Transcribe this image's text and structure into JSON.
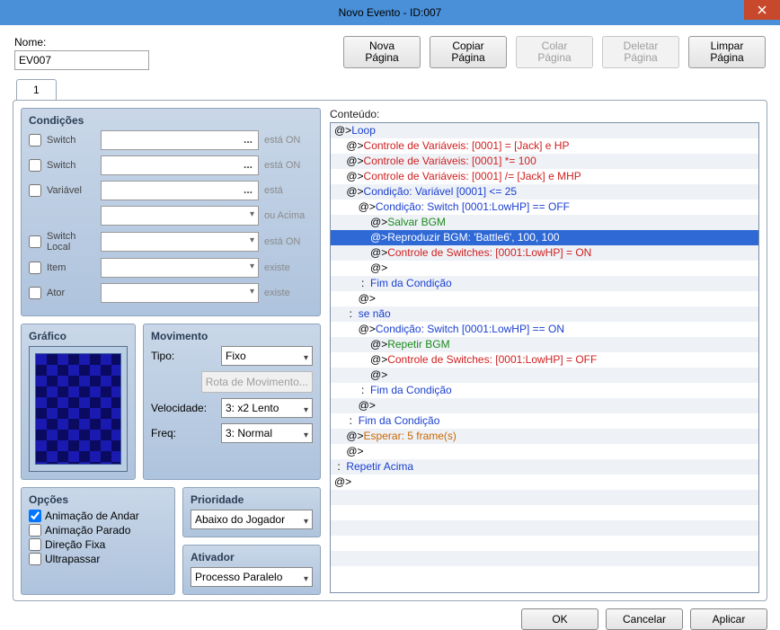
{
  "title": "Novo Evento - ID:007",
  "name": {
    "label": "Nome:",
    "value": "EV007"
  },
  "toolbar": {
    "nova": "Nova\nPágina",
    "copiar": "Copiar\nPágina",
    "colar": "Colar\nPágina",
    "deletar": "Deletar\nPágina",
    "limpar": "Limpar\nPágina"
  },
  "tabs": [
    "1"
  ],
  "conditions": {
    "title": "Condições",
    "rows": [
      {
        "label": "Switch",
        "suffix": "está ON",
        "type": "ellipsis"
      },
      {
        "label": "Switch",
        "suffix": "está ON",
        "type": "ellipsis"
      },
      {
        "label": "Variável",
        "suffix": "está",
        "type": "ellipsis"
      },
      {
        "label": "",
        "suffix": "ou Acima",
        "type": "combo",
        "indent": true
      },
      {
        "label": "Switch Local",
        "suffix": "está ON",
        "type": "combo"
      },
      {
        "label": "Item",
        "suffix": "existe",
        "type": "combo"
      },
      {
        "label": "Ator",
        "suffix": "existe",
        "type": "combo"
      }
    ]
  },
  "graphic": {
    "title": "Gráfico"
  },
  "movement": {
    "title": "Movimento",
    "type_label": "Tipo:",
    "type_value": "Fixo",
    "rota": "Rota de Movimento...",
    "speed_label": "Velocidade:",
    "speed_value": "3: x2 Lento",
    "freq_label": "Freq:",
    "freq_value": "3: Normal"
  },
  "options": {
    "title": "Opções",
    "items": [
      {
        "label": "Animação de Andar",
        "checked": true
      },
      {
        "label": "Animação Parado",
        "checked": false
      },
      {
        "label": "Direção Fixa",
        "checked": false
      },
      {
        "label": "Ultrapassar",
        "checked": false
      }
    ]
  },
  "priority": {
    "title": "Prioridade",
    "value": "Abaixo do Jogador"
  },
  "trigger": {
    "title": "Ativador",
    "value": "Processo Paralelo"
  },
  "content": {
    "title": "Conteúdo:",
    "lines": [
      {
        "indent": 0,
        "segs": [
          [
            "black",
            "@>"
          ],
          [
            "blue",
            "Loop"
          ]
        ]
      },
      {
        "indent": 1,
        "segs": [
          [
            "black",
            "@>"
          ],
          [
            "red",
            "Controle de Variáveis: [0001] = [Jack] e HP"
          ]
        ]
      },
      {
        "indent": 1,
        "segs": [
          [
            "black",
            "@>"
          ],
          [
            "red",
            "Controle de Variáveis: [0001] *= 100"
          ]
        ]
      },
      {
        "indent": 1,
        "segs": [
          [
            "black",
            "@>"
          ],
          [
            "red",
            "Controle de Variáveis: [0001] /= [Jack] e MHP"
          ]
        ]
      },
      {
        "indent": 1,
        "segs": [
          [
            "black",
            "@>"
          ],
          [
            "blue",
            "Condição: Variável [0001] <= 25"
          ]
        ]
      },
      {
        "indent": 2,
        "segs": [
          [
            "black",
            "@>"
          ],
          [
            "blue",
            "Condição: Switch [0001:LowHP] == OFF"
          ]
        ]
      },
      {
        "indent": 3,
        "segs": [
          [
            "black",
            "@>"
          ],
          [
            "green",
            "Salvar BGM"
          ]
        ]
      },
      {
        "indent": 3,
        "selected": true,
        "segs": [
          [
            "black",
            "@>"
          ],
          [
            "green",
            "Reproduzir BGM: 'Battle6', 100, 100"
          ]
        ]
      },
      {
        "indent": 3,
        "segs": [
          [
            "black",
            "@>"
          ],
          [
            "red",
            "Controle de Switches: [0001:LowHP] = ON"
          ]
        ]
      },
      {
        "indent": 3,
        "segs": [
          [
            "black",
            "@>"
          ]
        ]
      },
      {
        "indent": 2,
        "segs": [
          [
            "black",
            " :  "
          ],
          [
            "blue",
            "Fim da Condição"
          ]
        ]
      },
      {
        "indent": 2,
        "segs": [
          [
            "black",
            "@>"
          ]
        ]
      },
      {
        "indent": 1,
        "segs": [
          [
            "black",
            " :  "
          ],
          [
            "blue",
            "se não"
          ]
        ]
      },
      {
        "indent": 2,
        "segs": [
          [
            "black",
            "@>"
          ],
          [
            "blue",
            "Condição: Switch [0001:LowHP] == ON"
          ]
        ]
      },
      {
        "indent": 3,
        "segs": [
          [
            "black",
            "@>"
          ],
          [
            "green",
            "Repetir BGM"
          ]
        ]
      },
      {
        "indent": 3,
        "segs": [
          [
            "black",
            "@>"
          ],
          [
            "red",
            "Controle de Switches: [0001:LowHP] = OFF"
          ]
        ]
      },
      {
        "indent": 3,
        "segs": [
          [
            "black",
            "@>"
          ]
        ]
      },
      {
        "indent": 2,
        "segs": [
          [
            "black",
            " :  "
          ],
          [
            "blue",
            "Fim da Condição"
          ]
        ]
      },
      {
        "indent": 2,
        "segs": [
          [
            "black",
            "@>"
          ]
        ]
      },
      {
        "indent": 1,
        "segs": [
          [
            "black",
            " :  "
          ],
          [
            "blue",
            "Fim da Condição"
          ]
        ]
      },
      {
        "indent": 1,
        "segs": [
          [
            "black",
            "@>"
          ],
          [
            "orange",
            "Esperar: 5 frame(s)"
          ]
        ]
      },
      {
        "indent": 1,
        "segs": [
          [
            "black",
            "@>"
          ]
        ]
      },
      {
        "indent": 0,
        "segs": [
          [
            "black",
            " :  "
          ],
          [
            "blue",
            "Repetir Acima"
          ]
        ]
      },
      {
        "indent": 0,
        "segs": [
          [
            "black",
            "@>"
          ]
        ]
      }
    ]
  },
  "footer": {
    "ok": "OK",
    "cancel": "Cancelar",
    "apply": "Aplicar"
  }
}
